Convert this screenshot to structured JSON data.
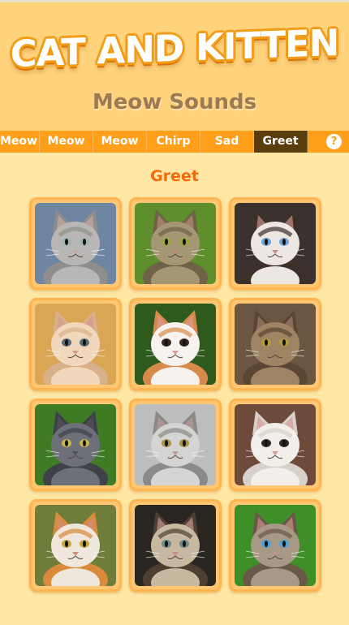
{
  "app": {
    "logo_text": "CAT AND KITTEN",
    "subtitle": "Meow Sounds"
  },
  "tabs": [
    {
      "label": "Meow"
    },
    {
      "label": "Meow"
    },
    {
      "label": "Meow"
    },
    {
      "label": "Chirp"
    },
    {
      "label": "Sad"
    },
    {
      "label": "Greet",
      "active": true
    }
  ],
  "help_label": "?",
  "section": {
    "title": "Greet"
  },
  "tiles": [
    {
      "name": "gray-fluffy-kitten",
      "bg": "#6f86a3",
      "fur": "#b8b7b5",
      "fur2": "#8f8e8c",
      "eye": "#9fb3b5",
      "nose": "#c9a7a1"
    },
    {
      "name": "tabby-kitten-in-branches",
      "bg": "#5f8f2c",
      "fur": "#a59774",
      "fur2": "#6f6247",
      "eye": "#9aa83a",
      "nose": "#b98a74"
    },
    {
      "name": "ragdoll-cat",
      "bg": "#3b3230",
      "fur": "#ece7e2",
      "fur2": "#3d3029",
      "eye": "#6fa3d6",
      "nose": "#c98f88"
    },
    {
      "name": "cream-kitten-in-grass",
      "bg": "#d9a654",
      "fur": "#f1d8bd",
      "fur2": "#d8b08a",
      "eye": "#5b6d78",
      "nose": "#d49a8e"
    },
    {
      "name": "white-orange-kitten",
      "bg": "#2f5a1e",
      "fur": "#f6f3ef",
      "fur2": "#d88a4a",
      "eye": "#3a2a1a",
      "nose": "#d89a96"
    },
    {
      "name": "tabby-cat-lying",
      "bg": "#6b5641",
      "fur": "#9e8462",
      "fur2": "#5a4632",
      "eye": "#b59b40",
      "nose": "#a07c6a"
    },
    {
      "name": "gray-cat-in-grass",
      "bg": "#3f7b25",
      "fur": "#6d7078",
      "fur2": "#3f4149",
      "eye": "#c8b848",
      "nose": "#55505a"
    },
    {
      "name": "silver-scottish-fold",
      "bg": "#bdbdbd",
      "fur": "#d4d4d2",
      "fur2": "#8a8a88",
      "eye": "#a9933f",
      "nose": "#bb9a94"
    },
    {
      "name": "white-persian-kitten",
      "bg": "#6e4a3a",
      "fur": "#f2efeb",
      "fur2": "#d7d1ca",
      "eye": "#2f2a28",
      "nose": "#d79c9a"
    },
    {
      "name": "orange-white-cat",
      "bg": "#6e7d3a",
      "fur": "#efe7dc",
      "fur2": "#d98a3a",
      "eye": "#c9a63a",
      "nose": "#d38b7e"
    },
    {
      "name": "tabby-kitten-looking-up",
      "bg": "#2a2622",
      "fur": "#c8b8a0",
      "fur2": "#4d3f31",
      "eye": "#6f8a8a",
      "nose": "#c8928a"
    },
    {
      "name": "blue-eyed-tabby-kitten",
      "bg": "#3f8f28",
      "fur": "#a89886",
      "fur2": "#6a5847",
      "eye": "#4aa2d8",
      "nose": "#c98f86"
    }
  ]
}
